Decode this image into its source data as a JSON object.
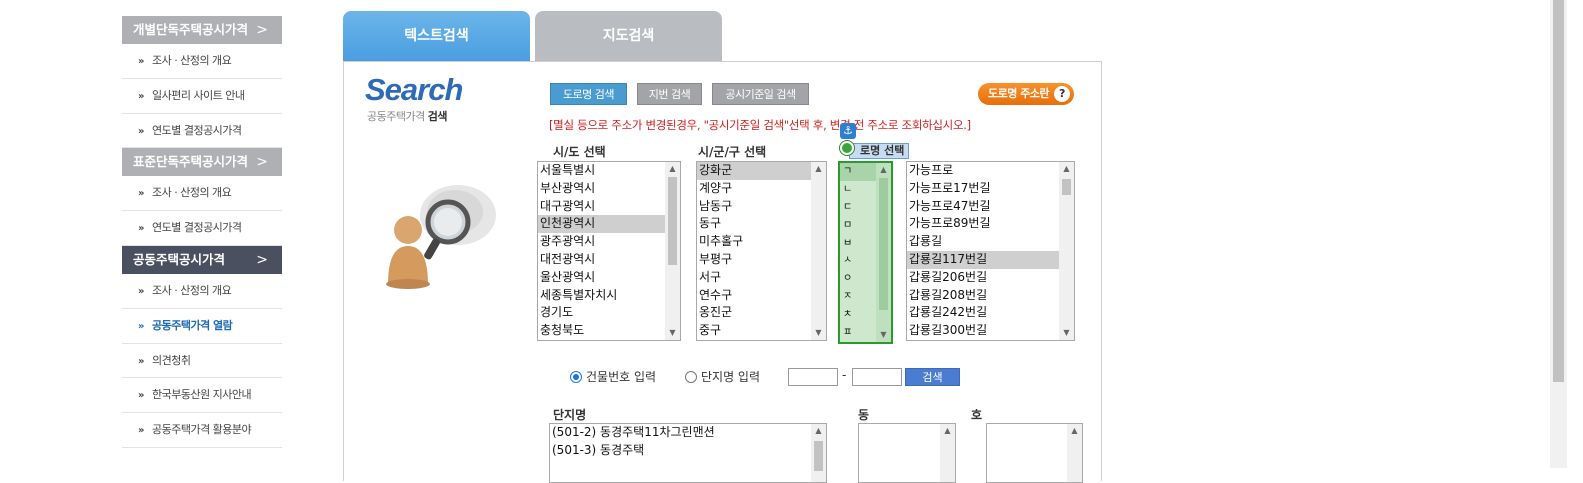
{
  "sidebar": {
    "sections": [
      {
        "title": "개별단독주택공시가격",
        "chev": ">",
        "items": [
          "조사 · 산정의 개요",
          "일사편리 사이트 안내",
          "연도별 결정공시가격"
        ]
      },
      {
        "title": "표준단독주택공시가격",
        "chev": ">",
        "items": [
          "조사 · 산정의 개요",
          "연도별 결정공시가격"
        ]
      },
      {
        "title": "공동주택공시가격",
        "chev": ">",
        "items": [
          "조사 · 산정의 개요",
          "공동주택가격 열람",
          "의견청취",
          "한국부동산원 지사안내",
          "공동주택가격 활용분야"
        ]
      }
    ],
    "bullet": "»"
  },
  "tabs": {
    "text_search": "텍스트검색",
    "map_search": "지도검색"
  },
  "logo": {
    "title": "Search",
    "sub_prefix": "공동주택가격 ",
    "sub_bold": "검색"
  },
  "modes": {
    "road": "도로명 검색",
    "lot": "지번 검색",
    "date": "공시기준일 검색"
  },
  "road_guide": {
    "label": "도로명 주소란",
    "icon": "?"
  },
  "notice": "[멸실 등으로 주소가 변경된경우, \"공시기준일 검색\"선택 후, 변경 전 주소로 조회하십시오.]",
  "labels": {
    "sido": "시/도 선택",
    "sgg": "시/군/구 선택",
    "road": "로명 선택",
    "complex": "단지명",
    "dong": "동",
    "ho": "호"
  },
  "sido_list": [
    "서울특별시",
    "부산광역시",
    "대구광역시",
    "인천광역시",
    "광주광역시",
    "대전광역시",
    "울산광역시",
    "세종특별자치시",
    "경기도",
    "충청북도"
  ],
  "sgg_list": [
    "강화군",
    "계양구",
    "남동구",
    "동구",
    "미추홀구",
    "부평구",
    "서구",
    "연수구",
    "옹진군",
    "중구"
  ],
  "consonants": [
    "ㄱ",
    "ㄴ",
    "ㄷ",
    "ㅁ",
    "ㅂ",
    "ㅅ",
    "ㅇ",
    "ㅈ",
    "ㅊ",
    "ㅍ"
  ],
  "road_list": [
    "가능프로",
    "가능프로17번길",
    "가능프로47번길",
    "가능프로89번길",
    "갑룡길",
    "갑룡길117번길",
    "갑룡길206번길",
    "갑룡길208번길",
    "갑룡길242번길",
    "갑룡길300번길"
  ],
  "radios": {
    "building_no": "건물번호 입력",
    "complex_name": "단지명 입력"
  },
  "search_button": "검색",
  "dash": "-",
  "complex_list": [
    "(501-2) 동경주택11차그린맨션",
    "(501-3) 동경주택"
  ],
  "icons": {
    "anchor": "⚓"
  }
}
